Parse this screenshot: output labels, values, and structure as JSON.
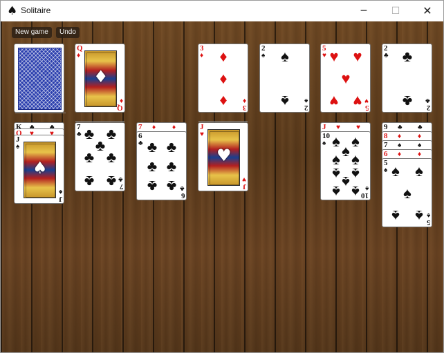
{
  "window": {
    "title": "Solitaire",
    "app_icon": "♠",
    "minimize": "─",
    "maximize": "☐",
    "close": "✕"
  },
  "toolbar": {
    "new_game": "New game",
    "undo": "Undo"
  },
  "stock": {
    "state": "face-down",
    "back_color": "#2b3fae"
  },
  "waste": {
    "rank": "Q",
    "suit": "♦"
  },
  "foundations": [
    {
      "rank": "3",
      "suit": "♦"
    },
    {
      "rank": "2",
      "suit": "♠"
    },
    {
      "rank": "5",
      "suit": "♥"
    },
    {
      "rank": "2",
      "suit": "♣"
    }
  ],
  "tableau": [
    {
      "peek": [
        {
          "rank": "K",
          "suit": "♣"
        },
        {
          "rank": "Q",
          "suit": "♥"
        }
      ],
      "top": {
        "rank": "J",
        "suit": "♠"
      }
    },
    {
      "peek": [],
      "top": {
        "rank": "7",
        "suit": "♣"
      }
    },
    {
      "peek": [
        {
          "rank": "7",
          "suit": "♦"
        }
      ],
      "top": {
        "rank": "6",
        "suit": "♣"
      }
    },
    {
      "peek": [],
      "top": {
        "rank": "J",
        "suit": "♥"
      }
    },
    {
      "peek": [],
      "top": null
    },
    {
      "peek": [
        {
          "rank": "J",
          "suit": "♥"
        }
      ],
      "top": {
        "rank": "10",
        "suit": "♠"
      }
    },
    {
      "peek": [
        {
          "rank": "9",
          "suit": "♣"
        },
        {
          "rank": "8",
          "suit": "♦"
        },
        {
          "rank": "7",
          "suit": "♠"
        },
        {
          "rank": "6",
          "suit": "♦"
        }
      ],
      "top": {
        "rank": "5",
        "suit": "♠"
      }
    }
  ],
  "colors": {
    "red_suit": "#d11",
    "black_suit": "#111",
    "table_wood": "#5b3a1c"
  }
}
